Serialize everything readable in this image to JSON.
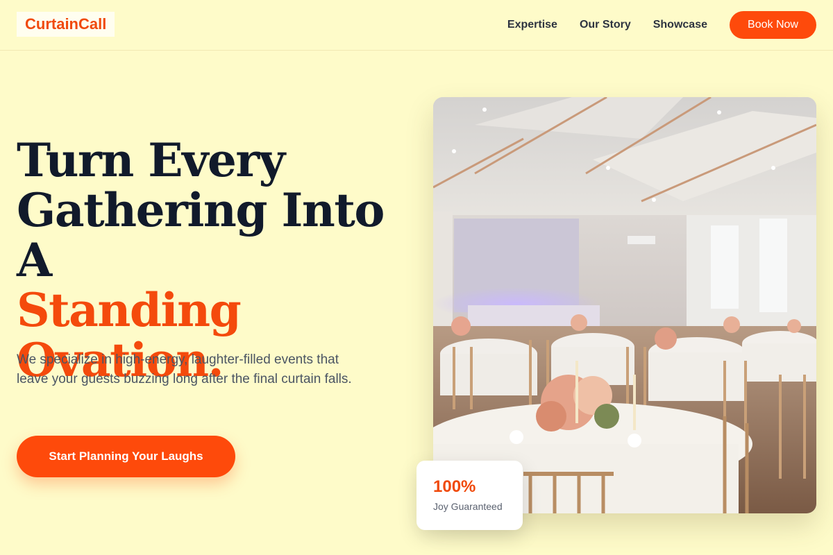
{
  "brand": {
    "logo_text": "CurtainCall",
    "accent_color": "#fe4a0b",
    "background_color": "#fefbc9"
  },
  "nav": {
    "links": [
      "Expertise",
      "Our Story",
      "Showcase"
    ],
    "cta_label": "Book Now"
  },
  "hero": {
    "title_line1": "Turn Every",
    "title_line2": "Gathering Into A",
    "title_accent1": "Standing",
    "title_accent2": "Ovation.",
    "description": "We specialize in high-energy, laughter-filled events that leave your guests buzzing long after the final curtain falls.",
    "cta_label": "Start Planning Your Laughs"
  },
  "stat": {
    "value": "100%",
    "label": "Joy Guaranteed"
  }
}
